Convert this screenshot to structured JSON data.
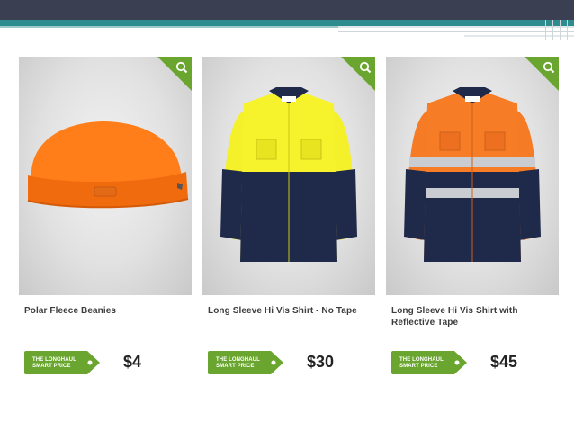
{
  "colors": {
    "header_dark": "#3b3f52",
    "header_teal": "#2f8c8e",
    "accent_green": "#6aa62f",
    "price_text": "#222222"
  },
  "products": [
    {
      "name": "Polar Fleece Beanies",
      "tag_line1": "THE LONGHAUL",
      "tag_line2": "SMART PRICE",
      "price": "$4",
      "image": "orange-beanie"
    },
    {
      "name": "Long Sleeve Hi Vis Shirt - No Tape",
      "tag_line1": "THE LONGHAUL",
      "tag_line2": "SMART PRICE",
      "price": "$30",
      "image": "yellow-navy-shirt"
    },
    {
      "name": "Long Sleeve Hi Vis Shirt with Reflective Tape",
      "tag_line1": "THE LONGHAUL",
      "tag_line2": "SMART PRICE",
      "price": "$45",
      "image": "orange-navy-shirt-reflective"
    }
  ],
  "icons": {
    "zoom": "magnifier-icon"
  }
}
